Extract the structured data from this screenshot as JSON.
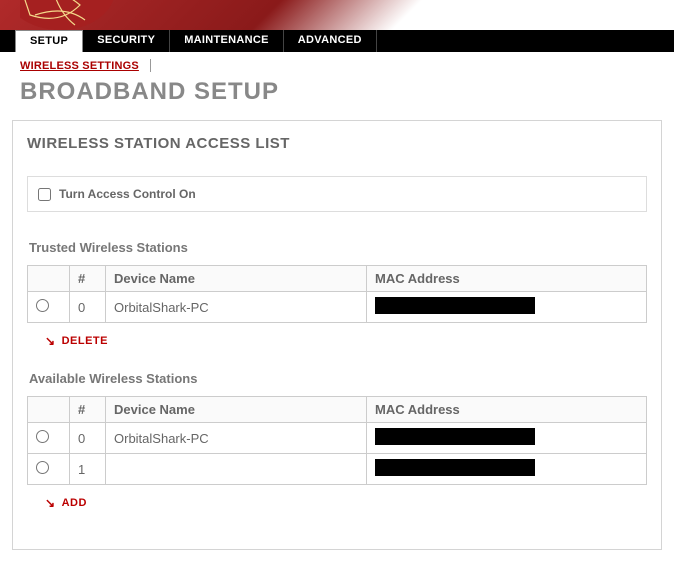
{
  "tabs": {
    "setup": "SETUP",
    "security": "SECURITY",
    "maintenance": "MAINTENANCE",
    "advanced": "ADVANCED"
  },
  "subnav": {
    "wireless_settings": "WIRELESS SETTINGS"
  },
  "page_title": "BROADBAND SETUP",
  "section_title": "WIRELESS STATION ACCESS LIST",
  "access_control_label": "Turn Access Control On",
  "columns": {
    "num": "#",
    "device": "Device Name",
    "mac": "MAC Address"
  },
  "trusted": {
    "title": "Trusted Wireless Stations",
    "rows": [
      {
        "num": "0",
        "device": "OrbitalShark-PC",
        "mac_hidden": true
      }
    ],
    "action": "DELETE"
  },
  "available": {
    "title": "Available Wireless Stations",
    "rows": [
      {
        "num": "0",
        "device": "OrbitalShark-PC",
        "mac_hidden": true
      },
      {
        "num": "1",
        "device": "",
        "mac_hidden": true
      }
    ],
    "action": "ADD"
  }
}
